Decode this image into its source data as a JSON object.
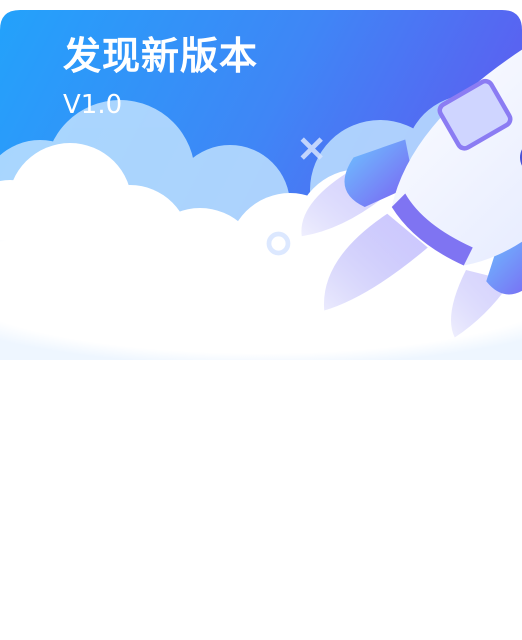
{
  "update_dialog": {
    "title": "发现新版本",
    "version": "V1.0"
  },
  "icons": {
    "illustration": "rocket-icon",
    "decoration": "sparkle-icon",
    "background": "cloud-icon"
  },
  "colors": {
    "gradient_start": "#29a1fb",
    "gradient_end": "#5e5cf0",
    "cloud": "#ffffff",
    "cloud_back": "#c9e6ff",
    "text": "#ffffff"
  }
}
